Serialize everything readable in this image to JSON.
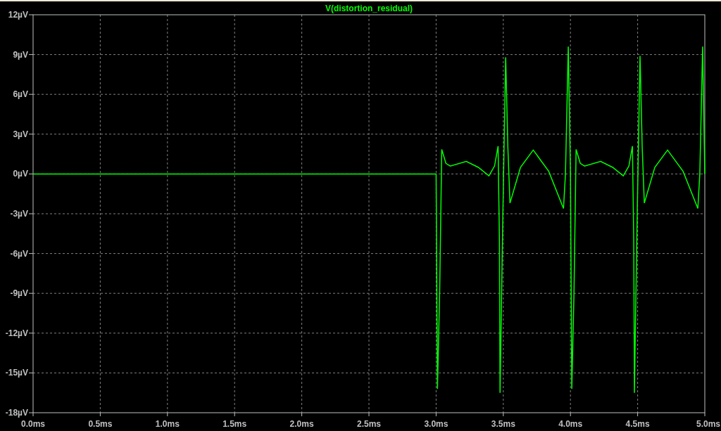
{
  "plot": {
    "chart_data": {
      "type": "line",
      "x": [
        0,
        3.0,
        3.01,
        3.026,
        3.042,
        3.073,
        3.105,
        3.225,
        3.314,
        3.393,
        3.435,
        3.461,
        3.471,
        3.476,
        3.497,
        3.518,
        3.534,
        3.55,
        3.628,
        3.723,
        3.838,
        3.948,
        3.963,
        3.984,
        4.0,
        4.01,
        4.026,
        4.042,
        4.073,
        4.105,
        4.225,
        4.314,
        4.393,
        4.435,
        4.461,
        4.471,
        4.476,
        4.497,
        4.518,
        4.534,
        4.55,
        4.628,
        4.723,
        4.838,
        4.948,
        4.963,
        4.984,
        5.0
      ],
      "series": [
        {
          "name": "V(distortion_residual)",
          "color": "#00ff00",
          "values": [
            0,
            0,
            -16.2,
            -9,
            1.85,
            0.8,
            0.6,
            0.95,
            0.5,
            -0.15,
            0.6,
            2.1,
            -5,
            -16.5,
            -3,
            8.8,
            2,
            -2.2,
            0.5,
            1.8,
            0.2,
            -2.6,
            0,
            9.6,
            0,
            -16.2,
            -9,
            1.85,
            0.8,
            0.6,
            0.95,
            0.5,
            -0.15,
            0.6,
            2.1,
            -5,
            -16.5,
            -3,
            8.9,
            2,
            -2.2,
            0.5,
            1.8,
            0.2,
            -2.6,
            0,
            9.6,
            0
          ]
        }
      ],
      "xlim": [
        0,
        5
      ],
      "ylim": [
        -18,
        12
      ],
      "grid": true,
      "xticks": [
        {
          "value": 0,
          "label": "0.0ms"
        },
        {
          "value": 0.5,
          "label": "0.5ms"
        },
        {
          "value": 1,
          "label": "1.0ms"
        },
        {
          "value": 1.5,
          "label": "1.5ms"
        },
        {
          "value": 2,
          "label": "2.0ms"
        },
        {
          "value": 2.5,
          "label": "2.5ms"
        },
        {
          "value": 3,
          "label": "3.0ms"
        },
        {
          "value": 3.5,
          "label": "3.5ms"
        },
        {
          "value": 4,
          "label": "4.0ms"
        },
        {
          "value": 4.5,
          "label": "4.5ms"
        },
        {
          "value": 5,
          "label": "5.0ms"
        }
      ],
      "yticks": [
        {
          "value": 12,
          "label": "12µV"
        },
        {
          "value": 9,
          "label": "9µV"
        },
        {
          "value": 6,
          "label": "6µV"
        },
        {
          "value": 3,
          "label": "3µV"
        },
        {
          "value": 0,
          "label": "0µV"
        },
        {
          "value": -3,
          "label": "-3µV"
        },
        {
          "value": -6,
          "label": "-6µV"
        },
        {
          "value": -9,
          "label": "-9µV"
        },
        {
          "value": -12,
          "label": "-12µV"
        },
        {
          "value": -15,
          "label": "-15µV"
        },
        {
          "value": -18,
          "label": "-18µV"
        }
      ]
    }
  }
}
